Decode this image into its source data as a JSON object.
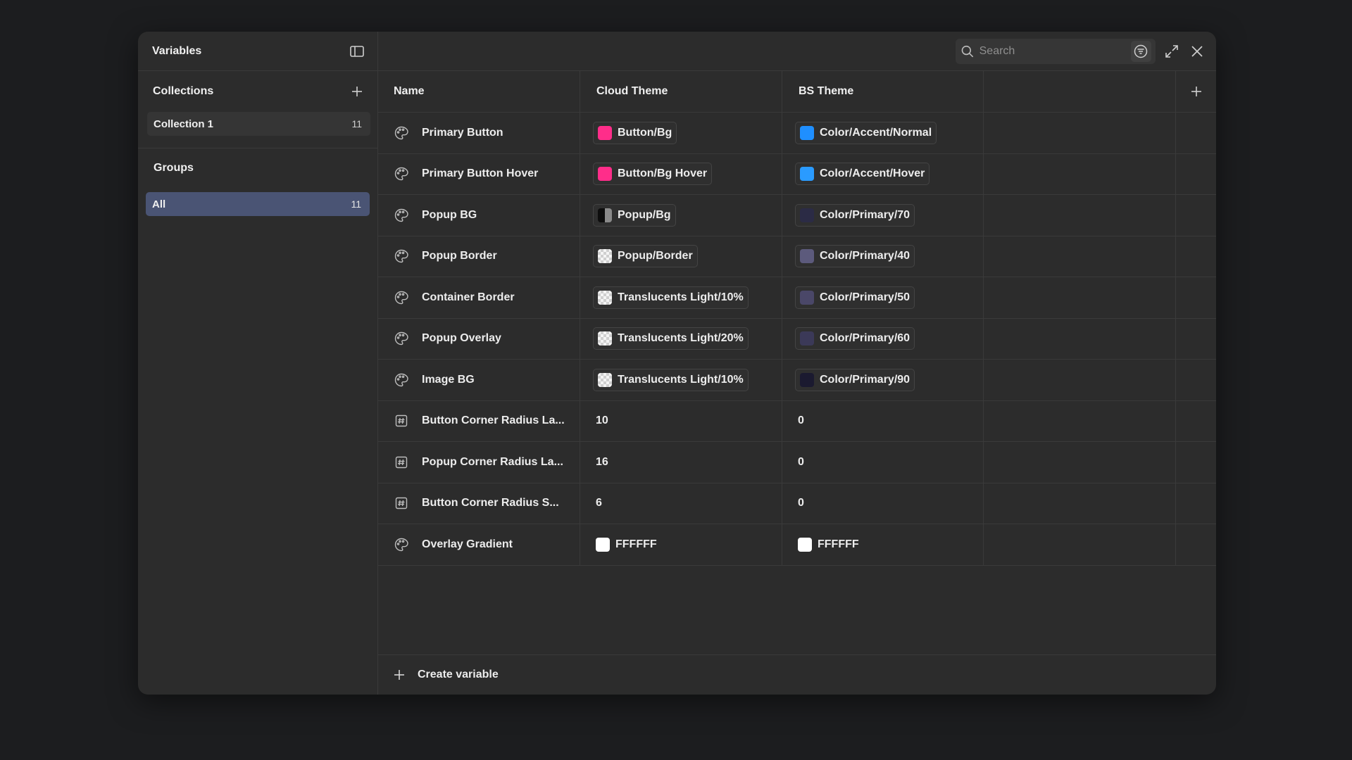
{
  "sidebar": {
    "title": "Variables",
    "collections_title": "Collections",
    "collection": {
      "label": "Collection 1",
      "count": "11"
    },
    "groups_title": "Groups",
    "group_all": {
      "label": "All",
      "count": "11"
    }
  },
  "toolbar": {
    "search_placeholder": "Search"
  },
  "table": {
    "headers": {
      "name": "Name",
      "cloud": "Cloud Theme",
      "bs": "BS Theme"
    },
    "rows": [
      {
        "type": "color",
        "name": "Primary Button",
        "cloud": {
          "label": "Button/Bg",
          "swatch": "#ff2d8a",
          "style": "solid"
        },
        "bs": {
          "label": "Color/Accent/Normal",
          "swatch": "#1f8fff",
          "style": "solid"
        }
      },
      {
        "type": "color",
        "name": "Primary Button Hover",
        "cloud": {
          "label": "Button/Bg Hover",
          "swatch": "#ff2d8a",
          "style": "solid"
        },
        "bs": {
          "label": "Color/Accent/Hover",
          "swatch": "#2a9bff",
          "style": "solid"
        }
      },
      {
        "type": "color",
        "name": "Popup BG",
        "cloud": {
          "label": "Popup/Bg",
          "swatch": "#111111",
          "style": "split"
        },
        "bs": {
          "label": "Color/Primary/70",
          "swatch": "#2b2b45",
          "style": "solid"
        }
      },
      {
        "type": "color",
        "name": "Popup Border",
        "cloud": {
          "label": "Popup/Border",
          "swatch": "#f4f4f4",
          "style": "checker"
        },
        "bs": {
          "label": "Color/Primary/40",
          "swatch": "#5c5a7c",
          "style": "solid"
        }
      },
      {
        "type": "color",
        "name": "Container Border",
        "cloud": {
          "label": "Translucents Light/10%",
          "swatch": "#f4f4f4",
          "style": "checker"
        },
        "bs": {
          "label": "Color/Primary/50",
          "swatch": "#4a4768",
          "style": "solid"
        }
      },
      {
        "type": "color",
        "name": "Popup Overlay",
        "cloud": {
          "label": "Translucents Light/20%",
          "swatch": "#f4f4f4",
          "style": "checker"
        },
        "bs": {
          "label": "Color/Primary/60",
          "swatch": "#3b3958",
          "style": "solid"
        }
      },
      {
        "type": "color",
        "name": "Image BG",
        "cloud": {
          "label": "Translucents Light/10%",
          "swatch": "#f4f4f4",
          "style": "checker"
        },
        "bs": {
          "label": "Color/Primary/90",
          "swatch": "#1b1a30",
          "style": "solid"
        }
      },
      {
        "type": "number",
        "name": "Button Corner Radius La...",
        "cloud": {
          "label": "10"
        },
        "bs": {
          "label": "0"
        }
      },
      {
        "type": "number",
        "name": "Popup Corner Radius La...",
        "cloud": {
          "label": "16"
        },
        "bs": {
          "label": "0"
        }
      },
      {
        "type": "number",
        "name": "Button Corner Radius S...",
        "cloud": {
          "label": "6"
        },
        "bs": {
          "label": "0"
        }
      },
      {
        "type": "hex",
        "name": "Overlay Gradient",
        "cloud": {
          "label": "FFFFFF",
          "swatch": "#ffffff",
          "style": "solid"
        },
        "bs": {
          "label": "FFFFFF",
          "swatch": "#ffffff",
          "style": "solid"
        }
      }
    ]
  },
  "footer": {
    "create_label": "Create variable"
  },
  "icons": {
    "sidebar_toggle": "sidebar-toggle-icon",
    "add": "plus-icon",
    "search": "search-icon",
    "filter": "filter-icon",
    "expand": "expand-icon",
    "close": "close-icon",
    "color_type": "palette-icon",
    "number_type": "number-icon"
  }
}
